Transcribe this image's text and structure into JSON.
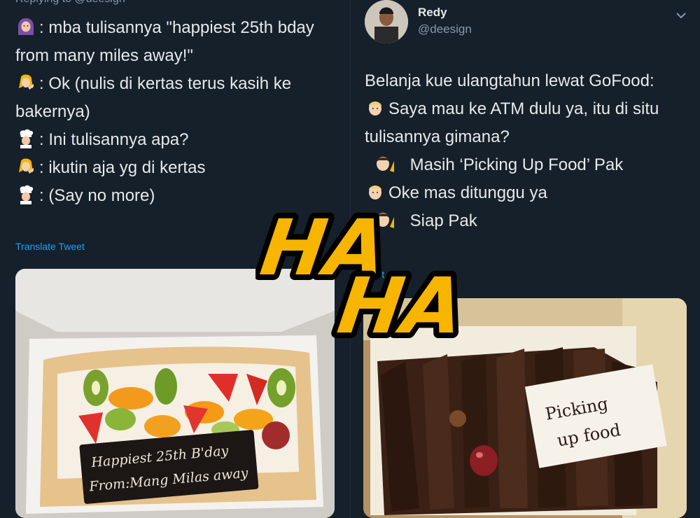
{
  "left_tweet": {
    "replying_to": "Replying to @deesign",
    "lines": [
      {
        "icon": "woman-headscarf-icon",
        "text": ": mba tulisannya \"happiest 25th bday"
      },
      {
        "icon": "",
        "text": "from many miles away!\""
      },
      {
        "icon": "woman-blonde-icon",
        "text": ": Ok (nulis di kertas terus kasih ke"
      },
      {
        "icon": "",
        "text": "bakernya)"
      },
      {
        "icon": "chef-icon",
        "text": ": Ini tulisannya apa?"
      },
      {
        "icon": "woman-blonde-icon",
        "text": ": ikutin aja yg di kertas"
      },
      {
        "icon": "chef-icon",
        "text": ": (Say no more)"
      }
    ],
    "translate_label": "Translate Tweet",
    "photo": {
      "cake_text_line1": "Happiest 25th B'day",
      "cake_text_line2": "From:Mang Milas away"
    }
  },
  "right_tweet": {
    "user_name": "Redy",
    "user_handle": "@deesign",
    "lines": [
      {
        "icon": "",
        "text": "Belanja kue ulangtahun lewat GoFood:"
      },
      {
        "icon": "man-blonde-icon",
        "text": "Saya mau ke ATM dulu ya, itu di situ"
      },
      {
        "icon": "",
        "text": "tulisannya gimana?"
      },
      {
        "icon": "man-hand-icon",
        "text": " Masih ‘Picking Up Food’ Pak"
      },
      {
        "icon": "man-blonde-icon",
        "text": "Oke mas ditunggu ya"
      },
      {
        "icon": "man-hand-icon",
        "text": " Siap Pak"
      }
    ],
    "translate_label_partial": "Tra          t",
    "photo": {
      "card_text_line1": "Picking",
      "card_text_line2": "up food"
    }
  },
  "overlay": {
    "word1": "HA",
    "word2": "HA"
  },
  "colors": {
    "background": "#15202b",
    "text": "#e7e9ea",
    "muted": "#8899a6",
    "link": "#1da1f2",
    "haha_fill": "#f7b500",
    "haha_outline": "#000000"
  }
}
